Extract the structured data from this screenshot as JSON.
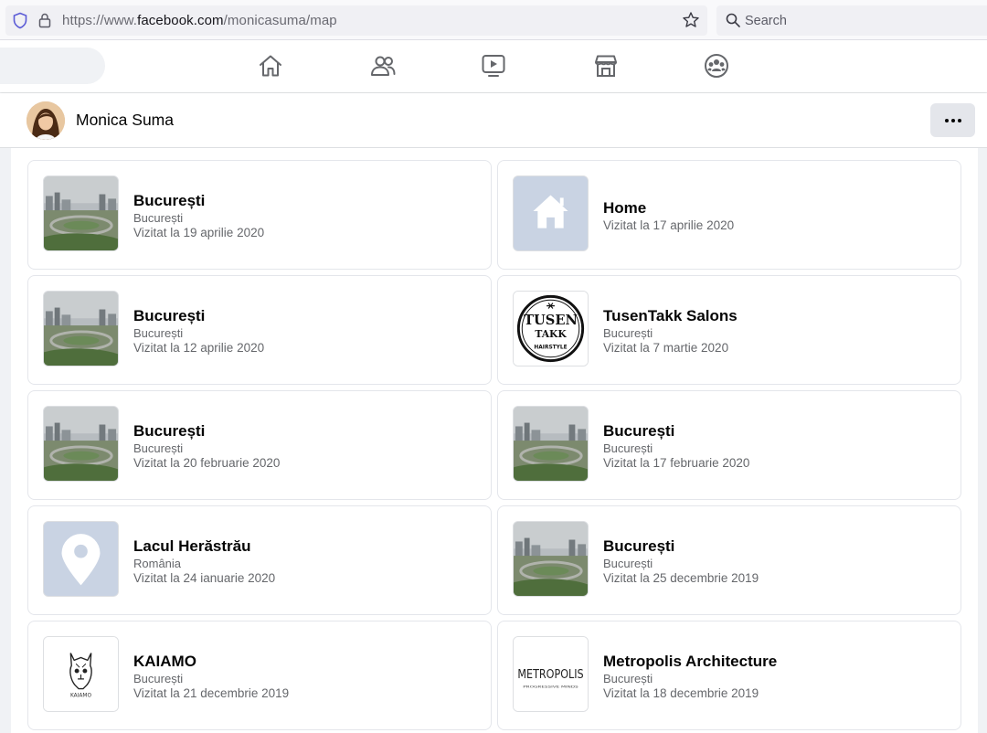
{
  "browser": {
    "url_prefix": "https://www.",
    "url_host": "facebook.com",
    "url_path": "/monicasuma/map",
    "search_placeholder": "Search"
  },
  "fb_nav": {
    "icons": [
      "home-icon",
      "friends-icon",
      "watch-icon",
      "marketplace-icon",
      "groups-icon"
    ]
  },
  "profile": {
    "name": "Monica Suma",
    "more_label": "..."
  },
  "places": [
    {
      "title": "București",
      "subtitle": "București",
      "date": "Vizitat la 19 aprilie 2020",
      "thumb": "city-photo"
    },
    {
      "title": "Home",
      "subtitle": "",
      "date": "Vizitat la 17 aprilie 2020",
      "thumb": "home-placeholder"
    },
    {
      "title": "București",
      "subtitle": "București",
      "date": "Vizitat la 12 aprilie 2020",
      "thumb": "city-photo"
    },
    {
      "title": "TusenTakk Salons",
      "subtitle": "București",
      "date": "Vizitat la 7 martie 2020",
      "thumb": "tusentakk-logo"
    },
    {
      "title": "București",
      "subtitle": "București",
      "date": "Vizitat la 20 februarie 2020",
      "thumb": "city-photo"
    },
    {
      "title": "București",
      "subtitle": "București",
      "date": "Vizitat la 17 februarie 2020",
      "thumb": "city-photo"
    },
    {
      "title": "Lacul Herăstrău",
      "subtitle": "România",
      "date": "Vizitat la 24 ianuarie 2020",
      "thumb": "pin-placeholder"
    },
    {
      "title": "București",
      "subtitle": "București",
      "date": "Vizitat la 25 decembrie 2019",
      "thumb": "city-photo"
    },
    {
      "title": "KAIAMO",
      "subtitle": "București",
      "date": "Vizitat la 21 decembrie 2019",
      "thumb": "kaiamo-logo"
    },
    {
      "title": "Metropolis Architecture",
      "subtitle": "București",
      "date": "Vizitat la 18 decembrie 2019",
      "thumb": "metropolis-logo"
    }
  ],
  "logo_text": {
    "tusen": "TUSEN",
    "takk": "TAKK",
    "hairstyle": "HAIRSTYLE",
    "kaiamo": "KAIAMO",
    "metropolis": "METROPOLIS",
    "metropolis_tag": "PROGRESSIVE MINDS"
  },
  "colors": {
    "placeholder_bg": "#c9d3e3",
    "nav_icon": "#65676b"
  }
}
